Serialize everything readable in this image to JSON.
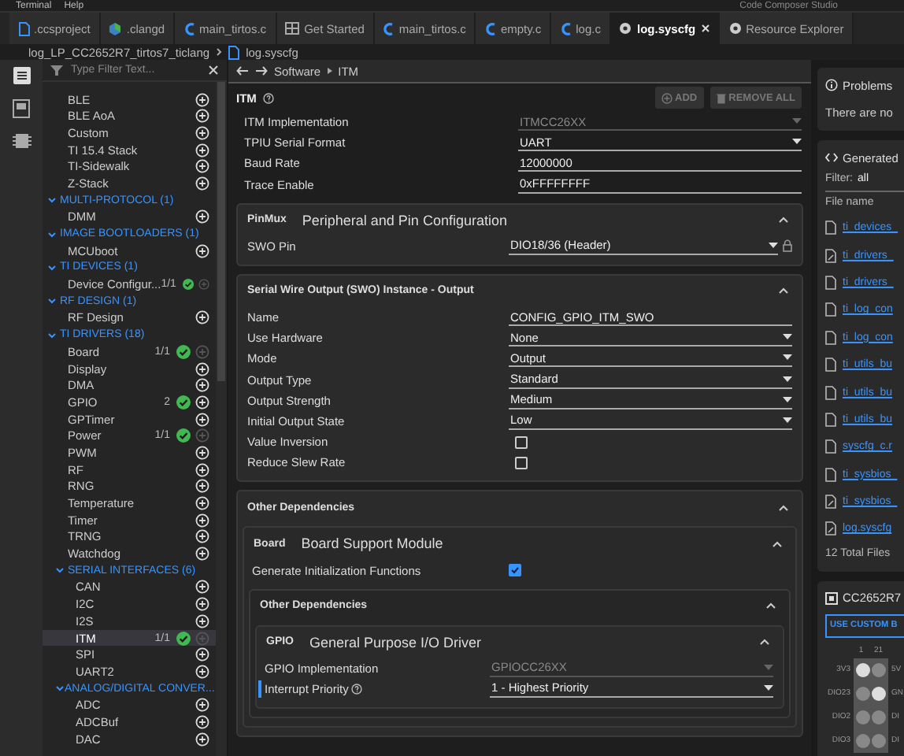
{
  "menu": [
    "Terminal",
    "Help"
  ],
  "app_title": "Code Composer Studio",
  "tabs": [
    {
      "label": ".ccsproject",
      "kind": "project",
      "selected": false
    },
    {
      "label": ".clangd",
      "kind": "clangd",
      "selected": false
    },
    {
      "label": "main_tirtos.c",
      "kind": "c",
      "selected": false
    },
    {
      "label": "Get Started",
      "kind": "start",
      "selected": false
    },
    {
      "label": "main_tirtos.c",
      "kind": "c",
      "selected": false
    },
    {
      "label": "empty.c",
      "kind": "c",
      "selected": false
    },
    {
      "label": "log.c",
      "kind": "c",
      "selected": false
    },
    {
      "label": "log.syscfg",
      "kind": "syscfg",
      "selected": true
    },
    {
      "label": "Resource Explorer",
      "kind": "syscfg",
      "selected": false
    }
  ],
  "breadcrumb": {
    "project": "log_LP_CC2652R7_tirtos7_ticlang",
    "file": "log.syscfg"
  },
  "sidebar": {
    "filter_placeholder": "Type Filter Text...",
    "tree": [
      {
        "kind": "module",
        "label": "BLE",
        "added": false,
        "selected": false
      },
      {
        "kind": "module",
        "label": "BLE AoA",
        "added": false,
        "selected": false
      },
      {
        "kind": "module",
        "label": "Custom",
        "added": false,
        "selected": false
      },
      {
        "kind": "module",
        "label": "TI 15.4 Stack",
        "added": false,
        "selected": false
      },
      {
        "kind": "module",
        "label": "TI-Sidewalk",
        "added": false,
        "selected": false
      },
      {
        "kind": "module",
        "label": "Z-Stack",
        "added": false,
        "selected": false
      },
      {
        "kind": "category",
        "label": "MULTI-PROTOCOL (1)",
        "expanded": true,
        "children": [
          {
            "kind": "module",
            "label": "DMM",
            "added": false,
            "selected": false
          }
        ]
      },
      {
        "kind": "category",
        "label": "IMAGE BOOTLOADERS (1)",
        "expanded": true,
        "children": [
          {
            "kind": "module",
            "label": "MCUboot",
            "added": false,
            "selected": false
          }
        ]
      },
      {
        "kind": "category",
        "label": "TI DEVICES (1)",
        "expanded": true,
        "children": [
          {
            "kind": "module",
            "label": "Device Configur...",
            "count": "1/1",
            "added": true,
            "selected": false,
            "add_enabled": false
          }
        ]
      },
      {
        "kind": "category",
        "label": "RF DESIGN (1)",
        "expanded": true,
        "children": [
          {
            "kind": "module",
            "label": "RF Design",
            "added": false,
            "selected": false
          }
        ]
      },
      {
        "kind": "category",
        "label": "TI DRIVERS (18)",
        "expanded": true,
        "children": [
          {
            "kind": "module",
            "label": "Board",
            "count": "1/1",
            "added": true,
            "selected": false,
            "add_enabled": false
          },
          {
            "kind": "module",
            "label": "Display",
            "added": false,
            "selected": false
          },
          {
            "kind": "module",
            "label": "DMA",
            "added": false,
            "selected": false
          },
          {
            "kind": "module",
            "label": "GPIO",
            "count": "2",
            "added": true,
            "selected": false,
            "add_enabled": true
          },
          {
            "kind": "module",
            "label": "GPTimer",
            "added": false,
            "selected": false
          },
          {
            "kind": "module",
            "label": "Power",
            "count": "1/1",
            "added": true,
            "selected": false,
            "add_enabled": false
          },
          {
            "kind": "module",
            "label": "PWM",
            "added": false,
            "selected": false
          },
          {
            "kind": "module",
            "label": "RF",
            "added": false,
            "selected": false
          },
          {
            "kind": "module",
            "label": "RNG",
            "added": false,
            "selected": false
          },
          {
            "kind": "module",
            "label": "Temperature",
            "added": false,
            "selected": false
          },
          {
            "kind": "module",
            "label": "Timer",
            "added": false,
            "selected": false
          },
          {
            "kind": "module",
            "label": "TRNG",
            "added": false,
            "selected": false
          },
          {
            "kind": "module",
            "label": "Watchdog",
            "added": false,
            "selected": false
          },
          {
            "kind": "category",
            "label": "SERIAL INTERFACES (6)",
            "expanded": true,
            "children": [
              {
                "kind": "module",
                "label": "CAN",
                "added": false,
                "selected": false
              },
              {
                "kind": "module",
                "label": "I2C",
                "added": false,
                "selected": false
              },
              {
                "kind": "module",
                "label": "I2S",
                "added": false,
                "selected": false
              },
              {
                "kind": "module",
                "label": "ITM",
                "count": "1/1",
                "added": true,
                "selected": true,
                "add_enabled": false
              },
              {
                "kind": "module",
                "label": "SPI",
                "added": false,
                "selected": false
              },
              {
                "kind": "module",
                "label": "UART2",
                "added": false,
                "selected": false
              }
            ]
          },
          {
            "kind": "category",
            "label": "ANALOG/DIGITAL CONVER...",
            "expanded": true,
            "children": [
              {
                "kind": "module",
                "label": "ADC",
                "added": false,
                "selected": false
              },
              {
                "kind": "module",
                "label": "ADCBuf",
                "added": false,
                "selected": false
              },
              {
                "kind": "module",
                "label": "DAC",
                "added": false,
                "selected": false
              }
            ]
          }
        ]
      }
    ]
  },
  "main": {
    "path": [
      "Software",
      "ITM"
    ],
    "title": "ITM",
    "buttons": [
      {
        "label": "ADD",
        "kind": "add",
        "disabled": true
      },
      {
        "label": "REMOVE ALL",
        "kind": "remove",
        "disabled": true
      }
    ],
    "fields": [
      {
        "label": "ITM Implementation",
        "kind": "readonly",
        "value": "ITMCC26XX"
      },
      {
        "label": "TPIU Serial Format",
        "kind": "select",
        "value": "UART"
      },
      {
        "label": "Baud Rate",
        "kind": "text",
        "value": "12000000"
      },
      {
        "label": "Trace Enable",
        "kind": "text",
        "value": "0xFFFFFFFF"
      }
    ],
    "cards": [
      {
        "tag": "PinMux",
        "title": "Peripheral and Pin Configuration",
        "expanded": true,
        "fields": [
          {
            "label": "SWO Pin",
            "kind": "select",
            "value": "DIO18/36 (Header)",
            "locked": true
          }
        ]
      },
      {
        "title": "Serial Wire Output (SWO) Instance - Output",
        "expanded": true,
        "fields": [
          {
            "label": "Name",
            "kind": "text",
            "value": "CONFIG_GPIO_ITM_SWO"
          },
          {
            "label": "Use Hardware",
            "kind": "select",
            "value": "None"
          },
          {
            "label": "Mode",
            "kind": "select",
            "value": "Output"
          },
          {
            "label": "Output Type",
            "kind": "select",
            "value": "Standard"
          },
          {
            "label": "Output Strength",
            "kind": "select",
            "value": "Medium"
          },
          {
            "label": "Initial Output State",
            "kind": "select",
            "value": "Low"
          },
          {
            "label": "Value Inversion",
            "kind": "checkbox",
            "checked": false
          },
          {
            "label": "Reduce Slew Rate",
            "kind": "checkbox",
            "checked": false
          }
        ]
      },
      {
        "title": "Other Dependencies",
        "expanded": true,
        "cards": [
          {
            "tag": "Board",
            "title": "Board Support Module",
            "expanded": true,
            "fields": [
              {
                "label": "Generate Initialization Functions",
                "kind": "checkbox",
                "checked": true
              }
            ],
            "cards": [
              {
                "title": "Other Dependencies",
                "expanded": true,
                "cards": [
                  {
                    "tag": "GPIO",
                    "title": "General Purpose I/O Driver",
                    "expanded": true,
                    "fields": [
                      {
                        "label": "GPIO Implementation",
                        "kind": "readonly",
                        "value": "GPIOCC26XX",
                        "modified": false,
                        "help": false
                      },
                      {
                        "label": "Interrupt Priority",
                        "kind": "select",
                        "value": "1 - Highest Priority",
                        "modified": true,
                        "help": true
                      }
                    ]
                  }
                ]
              }
            ]
          }
        ]
      }
    ]
  },
  "right": {
    "problems": {
      "title": "Problems",
      "message": "There are no"
    },
    "generated": {
      "title": "Generated",
      "filter_label": "Filter:",
      "filter_value": "all",
      "column": "File name",
      "files": [
        {
          "name": "ti_devices_",
          "kind": "file"
        },
        {
          "name": "ti_drivers_",
          "kind": "edited"
        },
        {
          "name": "ti_drivers_",
          "kind": "file"
        },
        {
          "name": "ti_log_con",
          "kind": "file"
        },
        {
          "name": "ti_log_con",
          "kind": "file"
        },
        {
          "name": "ti_utils_bu",
          "kind": "file"
        },
        {
          "name": "ti_utils_bu",
          "kind": "file"
        },
        {
          "name": "ti_utils_bu",
          "kind": "file"
        },
        {
          "name": "syscfg_c.r",
          "kind": "file"
        },
        {
          "name": "ti_sysbios_",
          "kind": "file"
        },
        {
          "name": "ti_sysbios_",
          "kind": "edited"
        },
        {
          "name": "log.syscfg",
          "kind": "edited"
        }
      ],
      "total": "12 Total Files"
    },
    "device": {
      "title": "CC2652R7",
      "button": "USE CUSTOM B",
      "pin_numbers": [
        "1",
        "21"
      ],
      "left_pins": [
        "3V3",
        "DIO23",
        "DIO2",
        "DIO3"
      ],
      "right_pins": [
        "5V",
        "GN",
        "DI",
        "DI"
      ]
    }
  }
}
